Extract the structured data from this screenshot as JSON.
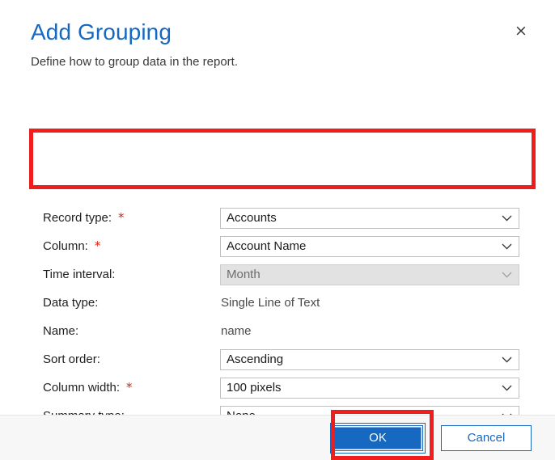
{
  "dialog": {
    "title": "Add Grouping",
    "subtitle": "Define how to group data in the report.",
    "close_label": "×"
  },
  "form": {
    "required_marker": "*",
    "rows": [
      {
        "label": "Record type:",
        "required": true,
        "control": "dropdown",
        "value": "Accounts",
        "disabled": false
      },
      {
        "label": "Column:",
        "required": true,
        "control": "dropdown",
        "value": "Account Name",
        "disabled": false
      },
      {
        "label": "Time interval:",
        "required": false,
        "control": "dropdown",
        "value": "Month",
        "disabled": true
      },
      {
        "label": "Data type:",
        "required": false,
        "control": "text",
        "value": "Single Line of Text",
        "disabled": false
      },
      {
        "label": "Name:",
        "required": false,
        "control": "text",
        "value": "name",
        "disabled": false
      },
      {
        "label": "Sort order:",
        "required": false,
        "control": "dropdown",
        "value": "Ascending",
        "disabled": false
      },
      {
        "label": "Column width:",
        "required": true,
        "control": "dropdown",
        "value": "100 pixels",
        "disabled": false
      },
      {
        "label": "Summary type:",
        "required": false,
        "control": "dropdown",
        "value": "None",
        "disabled": false
      }
    ]
  },
  "footer": {
    "ok_label": "OK",
    "cancel_label": "Cancel"
  },
  "colors": {
    "title_blue": "#1668c1",
    "primary_button": "#1668c1",
    "annotation_red": "#f01d1d",
    "required_star": "#d62311",
    "footer_background": "#f7f7f7",
    "disabled_field": "#e2e2e2"
  },
  "annotations": [
    {
      "name": "highlight-record-type-and-column",
      "color": "#f01d1d"
    },
    {
      "name": "highlight-ok-button",
      "color": "#f01d1d"
    }
  ]
}
